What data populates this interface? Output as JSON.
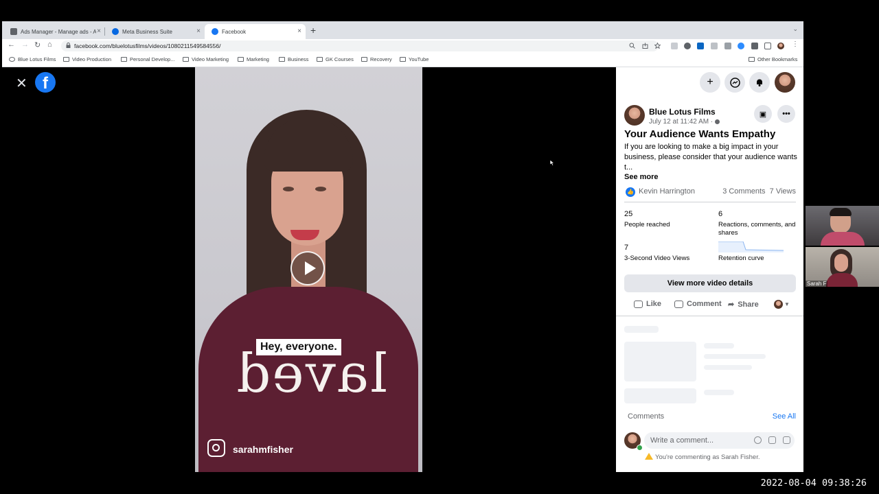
{
  "browser": {
    "tabs": [
      {
        "title": "Ads Manager - Manage ads - A",
        "active": false
      },
      {
        "title": "Meta Business Suite",
        "active": false
      },
      {
        "title": "Facebook",
        "active": true
      }
    ],
    "url": "facebook.com/bluelotusfilms/videos/1080211549584556/",
    "bookmarks": [
      "Blue Lotus Films",
      "Video Production",
      "Personal Develop...",
      "Video Marketing",
      "Marketing",
      "Business",
      "GK Courses",
      "Recovery",
      "YouTube"
    ],
    "other_bookmarks": "Other Bookmarks"
  },
  "video": {
    "caption": "Hey, everyone.",
    "instagram_handle": "sarahmfisher",
    "shirt_text": "laved"
  },
  "post": {
    "page_name": "Blue Lotus Films",
    "date": "July 12 at 11:42 AM ·",
    "title": "Your Audience Wants Empathy",
    "description": "If you are looking to make a big impact in your business, please consider that your audience wants t...",
    "see_more": "See more",
    "liker": "Kevin Harrington",
    "comments_count": "3 Comments",
    "views_count": "7 Views",
    "stats": [
      {
        "value": "25",
        "label": "People reached"
      },
      {
        "value": "6",
        "label": "Reactions, comments, and shares"
      },
      {
        "value": "7",
        "label": "3-Second Video Views"
      },
      {
        "value": "",
        "label": "Retention curve"
      }
    ],
    "view_more_details": "View more video details",
    "actions": {
      "like": "Like",
      "comment": "Comment",
      "share": "Share"
    },
    "comments_label": "Comments",
    "see_all": "See All",
    "comment_placeholder": "Write a comment...",
    "commenting_as": "You're commenting as Sarah Fisher."
  },
  "webcams": [
    {
      "name": ""
    },
    {
      "name": "Sarah F"
    }
  ],
  "timestamp": "2022-08-04 09:38:26",
  "colors": {
    "facebook_blue": "#1877f2",
    "shirt": "#5c1f32"
  }
}
